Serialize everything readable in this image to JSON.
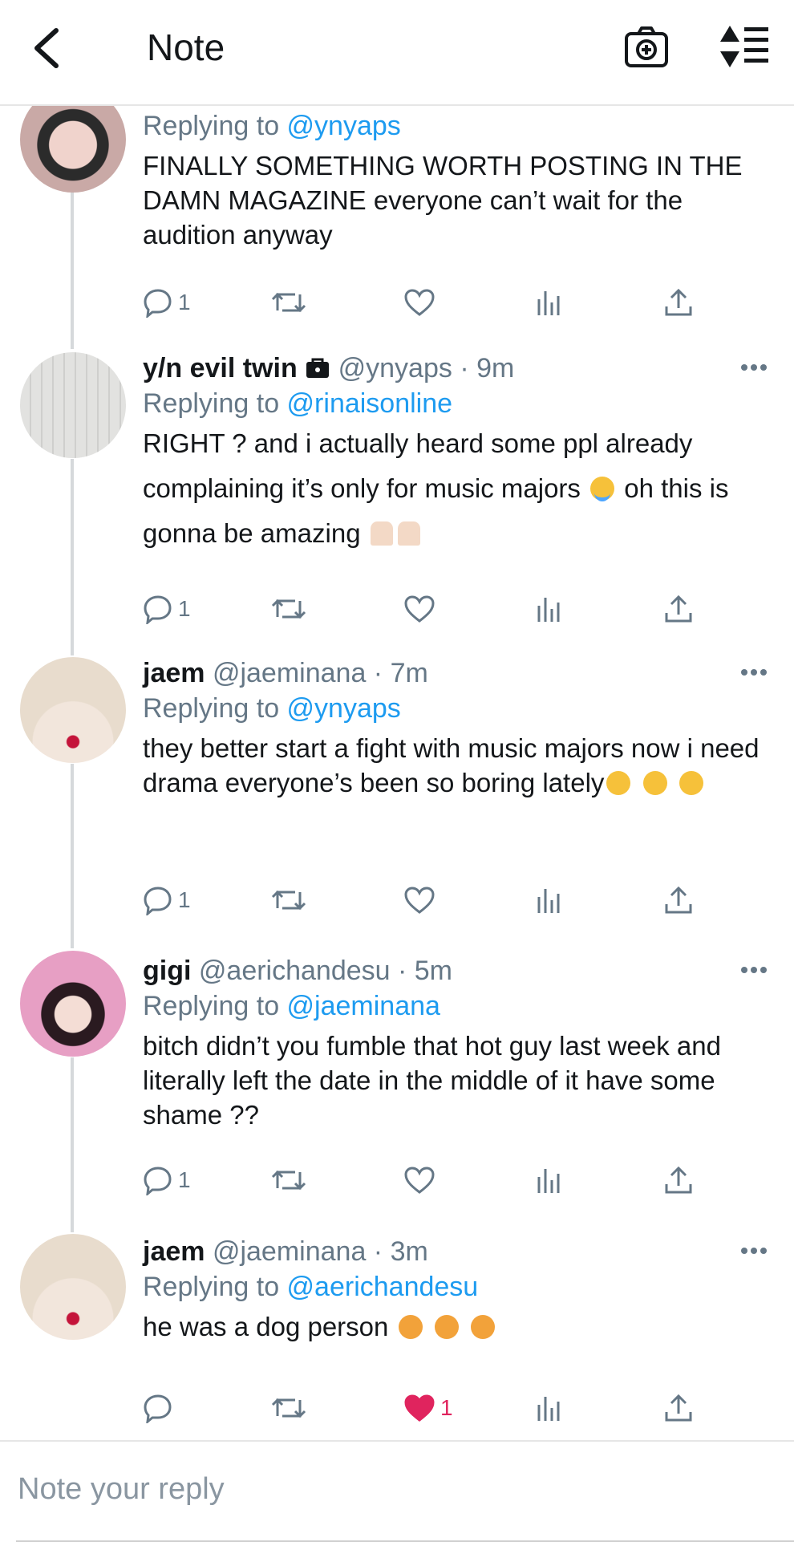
{
  "header": {
    "title": "Note"
  },
  "tweets": [
    {
      "replying_prefix": "Replying to ",
      "replying_to": "@ynyaps",
      "text": "FINALLY SOMETHING WORTH POSTING IN THE DAMN MAGAZINE everyone can’t wait for the audition anyway",
      "reply_count": "1",
      "avatar_colors": [
        "#c9a9a6",
        "#2b2b2b"
      ]
    },
    {
      "display_name": "y/n evil twin",
      "handle": "@ynyaps · 9m",
      "replying_prefix": "Replying to ",
      "replying_to": "@rinaisonline",
      "text_a": "RIGHT ? and i actually heard some ppl already complaining it’s only for music majors",
      "text_b": " oh this is gonna be amazing",
      "reply_count": "1",
      "avatar_colors": [
        "#d8d8d6",
        "#bdbdbb"
      ]
    },
    {
      "display_name": "jaem",
      "handle": "@jaeminana · 7m",
      "replying_prefix": "Replying to ",
      "replying_to": "@ynyaps",
      "text": "they better start a fight with music majors now i need drama everyone’s been so boring lately",
      "reply_count": "1",
      "avatar_colors": [
        "#eadfd3",
        "#d9c9b8"
      ]
    },
    {
      "display_name": "gigi",
      "handle": "@aerichandesu · 5m",
      "replying_prefix": "Replying to ",
      "replying_to": "@jaeminana",
      "text": "bitch didn’t you fumble that hot guy last week and literally left the date in the middle of it have some shame ??",
      "reply_count": "1",
      "avatar_colors": [
        "#e79fc4",
        "#5b2b3c"
      ]
    },
    {
      "display_name": "jaem",
      "handle": "@jaeminana · 3m",
      "replying_prefix": "Replying to ",
      "replying_to": "@aerichandesu",
      "text": "he was a dog person",
      "like_count": "1",
      "avatar_colors": [
        "#eadfd3",
        "#d9c9b8"
      ]
    }
  ],
  "reply_bar": {
    "placeholder": "Note your reply"
  },
  "colors": {
    "accent": "#1d9bf0",
    "like": "#e0245e",
    "muted": "#657786"
  }
}
